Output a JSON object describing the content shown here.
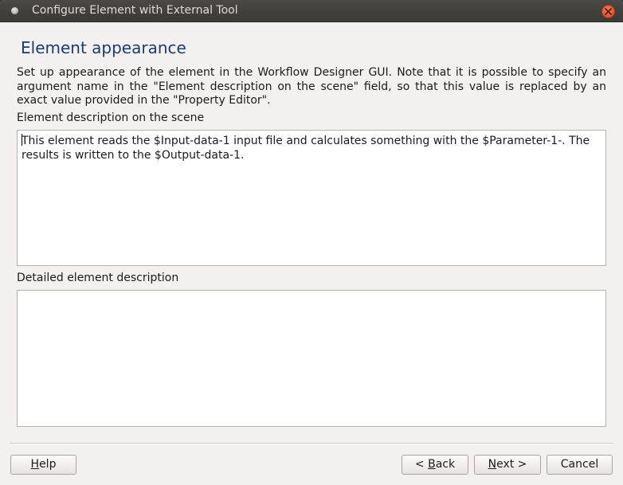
{
  "window": {
    "title": "Configure Element with External Tool"
  },
  "page": {
    "heading": "Element appearance",
    "description": "Set up appearance of the element in the Workflow Designer GUI. Note that it is possible to specify an argument name in the \"Element description on the scene\" field, so that this value is replaced by an exact value provided in the \"Property Editor\"."
  },
  "scene_description": {
    "label": "Element description on the scene",
    "value": "This element reads the $Input-data-1 input file and calculates something with the $Parameter-1-. The results is written to the $Output-data-1."
  },
  "detailed_description": {
    "label": "Detailed element description",
    "value": ""
  },
  "buttons": {
    "help": {
      "mnemonic": "H",
      "rest": "elp"
    },
    "back": {
      "prefix": "< ",
      "mnemonic": "B",
      "rest": "ack"
    },
    "next": {
      "mnemonic": "N",
      "rest": "ext >"
    },
    "cancel": "Cancel"
  },
  "colors": {
    "heading": "#1e3a6e",
    "titlebar": "#3c3b37",
    "close": "#e05a30"
  }
}
